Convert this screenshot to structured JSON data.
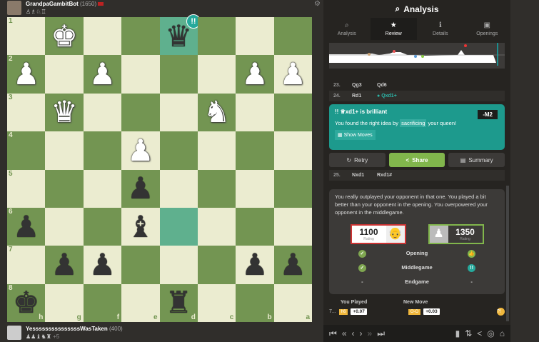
{
  "top_player": {
    "name": "GrandpaGambitBot",
    "rating": "(1650)",
    "captured": "♙♗♘♖"
  },
  "bottom_player": {
    "name": "YesssssssssssssssWasTaken",
    "rating": "(400)",
    "captured": "♟♟♝♞♜",
    "extra": "+5"
  },
  "board": {
    "ranks": [
      "1",
      "2",
      "3",
      "4",
      "5",
      "6",
      "7",
      "8"
    ],
    "files": [
      "h",
      "g",
      "f",
      "e",
      "d",
      "c",
      "b",
      "a"
    ],
    "pieces": [
      [
        "",
        "wk",
        "",
        "",
        "bq",
        "",
        "",
        ""
      ],
      [
        "wp",
        "",
        "wp",
        "",
        "",
        "",
        "wp",
        "wp"
      ],
      [
        "",
        "wq",
        "",
        "",
        "",
        "wn",
        "",
        ""
      ],
      [
        "",
        "",
        "",
        "wp",
        "",
        "",
        "",
        ""
      ],
      [
        "",
        "",
        "",
        "bp",
        "",
        "",
        "",
        ""
      ],
      [
        "bp",
        "",
        "",
        "bb",
        "",
        "",
        "",
        ""
      ],
      [
        "",
        "bp",
        "bp",
        "",
        "",
        "",
        "bp",
        "bp"
      ],
      [
        "bk",
        "",
        "",
        "",
        "br",
        "",
        "",
        ""
      ]
    ],
    "highlights": [
      "0-4",
      "5-4"
    ],
    "brilliant_badge": "!!",
    "colors": {
      "light": "#ebecd0",
      "dark": "#739552",
      "highlight": "#5fb08e"
    }
  },
  "panel": {
    "title": "Analysis",
    "tabs": [
      {
        "label": "Analysis",
        "icon": "⌕"
      },
      {
        "label": "Review",
        "icon": "★"
      },
      {
        "label": "Details",
        "icon": "ℹ"
      },
      {
        "label": "Openings",
        "icon": "▣"
      }
    ],
    "moves": [
      {
        "n": "23.",
        "w": "Qg3",
        "b": "Qd6"
      },
      {
        "n": "24.",
        "w": "Rd1",
        "b": "Qxd1+"
      }
    ],
    "card": {
      "badge": "!!",
      "title": "♕xd1+ is brilliant",
      "eval": "-M2",
      "text_pre": "You found the right idea by",
      "highlight": "sacrificing",
      "text_post": "your queen!",
      "show_moves": "Show Moves"
    },
    "buttons": {
      "retry": "Retry",
      "share": "Share",
      "summary": "Summary"
    },
    "move25": {
      "n": "25.",
      "w": "Nxd1",
      "b": "Rxd1#"
    },
    "review_text": "You really outplayed your opponent in that one. You played a bit better than your opponent in the opening. You overpowered your opponent in the middlegame.",
    "ratings": [
      {
        "value": "1100",
        "label": "Rating"
      },
      {
        "value": "1350",
        "label": "Rating"
      }
    ],
    "phases": [
      {
        "name": "Opening",
        "left": "✓",
        "right": "👍"
      },
      {
        "name": "Middlegame",
        "left": "✓",
        "right": "!!"
      },
      {
        "name": "Endgame",
        "left": "-",
        "right": "-"
      }
    ],
    "you_played": {
      "label": "You Played",
      "move_no": "7...",
      "move": "h6",
      "eval": "+0.07"
    },
    "new_move": {
      "label": "New Move",
      "move": "O-O",
      "eval": "+0.03",
      "badge": "?!"
    }
  }
}
